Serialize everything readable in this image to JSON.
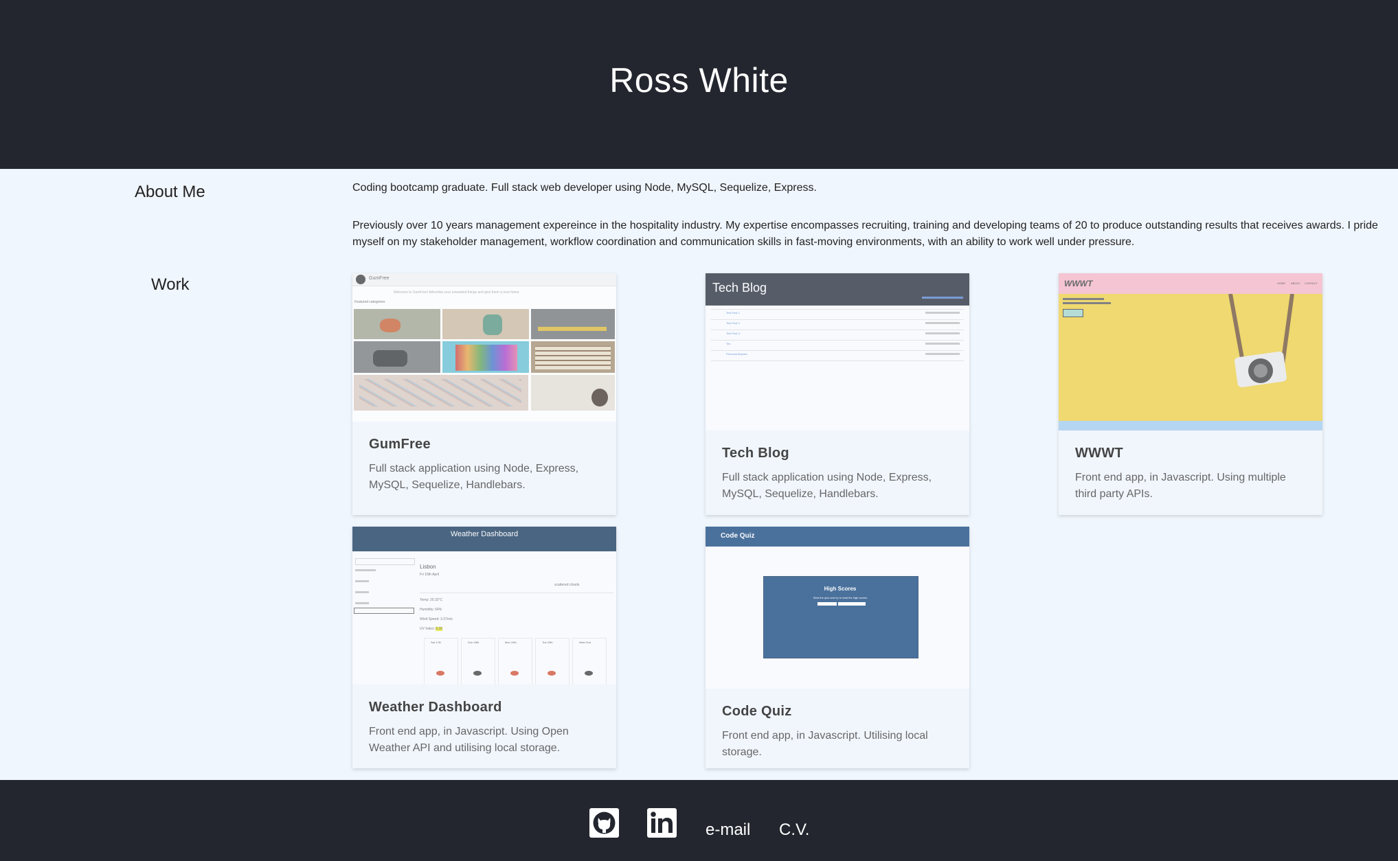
{
  "header": {
    "name": "Ross White"
  },
  "about": {
    "label": "About Me",
    "p1": "Coding bootcamp graduate. Full stack web developer using Node, MySQL, Sequelize, Express.",
    "p2": "Previously over 10 years management expereince in the hospitality industry. My expertise encompasses recruiting, training and developing teams of 20 to produce outstanding results that receives awards. I pride myself on my stakeholder management, workflow coordination and communication skills in fast-moving environments, with an ability to work well under pressure."
  },
  "work": {
    "label": "Work",
    "projects": [
      {
        "title": "GumFree",
        "desc": "Full stack application using Node, Express, MySQL, Sequelize, Handlebars."
      },
      {
        "title": "Tech Blog",
        "desc": "Full stack application using Node, Express, MySQL, Sequelize, Handlebars."
      },
      {
        "title": "WWWT",
        "desc": "Front end app, in Javascript. Using multiple third party APIs."
      },
      {
        "title": "Weather Dashboard",
        "desc": "Front end app, in Javascript. Using Open Weather API and utilising local storage."
      },
      {
        "title": "Code Quiz",
        "desc": "Front end app, in Javascript. Utilising local storage."
      }
    ]
  },
  "thumbs": {
    "gumfree": {
      "brand": "GumFree",
      "tagline": "Welcome to GumFree! Advertise your unwanted things and give them a new home",
      "section": "Featured categories"
    },
    "techblog": {
      "header": "Tech Blog",
      "posts": [
        "Test Post 1",
        "Test Post 2",
        "Test Post 3",
        "Tes",
        "Personal Abyssin"
      ]
    },
    "wwwt": {
      "logo": "WWWT",
      "nav": [
        "HOME",
        "ABOUT",
        "CONTACT"
      ]
    },
    "weather": {
      "header": "Weather Dashboard",
      "city": "Lisbon",
      "date": "Fri 16th April",
      "cond": "scattered clouds",
      "stats": [
        "Temp: 20.32°C",
        "Humidity: 64%",
        "Wind Speed: 3.37m/s",
        "UV Index: 6.26"
      ],
      "days": [
        "Sat 17th",
        "Sun 18th",
        "Mon 19th",
        "Tue 20th",
        "Wed 21st"
      ]
    },
    "quiz": {
      "header": "Code Quiz",
      "title": "High Scores",
      "text": "Start the quiz and try to beat the high scores"
    }
  },
  "footer": {
    "email": "e-mail",
    "cv": "C.V."
  }
}
